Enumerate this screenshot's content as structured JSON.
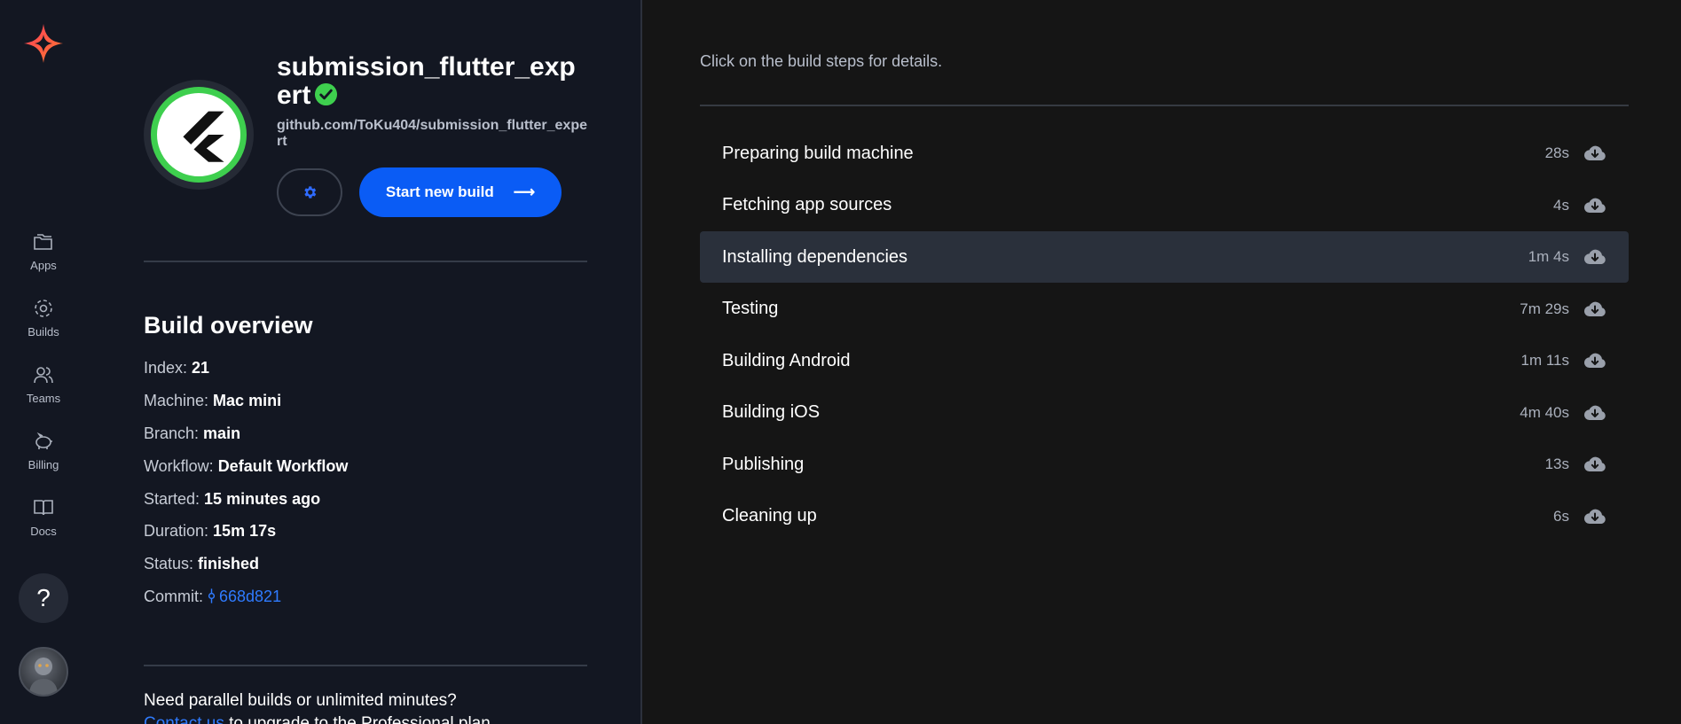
{
  "nav": {
    "items": [
      {
        "label": "Apps",
        "icon": "folder-icon"
      },
      {
        "label": "Builds",
        "icon": "builds-icon"
      },
      {
        "label": "Teams",
        "icon": "users-icon"
      },
      {
        "label": "Billing",
        "icon": "piggy-bank-icon"
      },
      {
        "label": "Docs",
        "icon": "book-icon"
      }
    ],
    "help_label": "?"
  },
  "app": {
    "name": "submission_flutter_expert",
    "repo": "github.com/ToKu404/submission_flutter_expert",
    "start_build_label": "Start new build",
    "start_build_arrow": "⟶"
  },
  "overview": {
    "title": "Build overview",
    "rows": [
      {
        "label": "Index: ",
        "value": "21"
      },
      {
        "label": "Machine: ",
        "value": "Mac mini"
      },
      {
        "label": "Branch: ",
        "value": "main"
      },
      {
        "label": "Workflow: ",
        "value": "Default Workflow"
      },
      {
        "label": "Started: ",
        "value": "15 minutes ago"
      },
      {
        "label": "Duration: ",
        "value": "15m 17s"
      },
      {
        "label": "Status: ",
        "value": "finished"
      }
    ],
    "commit_label": "Commit: ",
    "commit_value": "668d821"
  },
  "promo": {
    "line1": "Need parallel builds or unlimited minutes?",
    "link": "Contact us",
    "line2": " to upgrade to the Professional plan."
  },
  "steps_panel": {
    "hint": "Click on the build steps for details.",
    "steps": [
      {
        "name": "Preparing build machine",
        "time": "28s"
      },
      {
        "name": "Fetching app sources",
        "time": "4s"
      },
      {
        "name": "Installing dependencies",
        "time": "1m 4s",
        "active": true
      },
      {
        "name": "Testing",
        "time": "7m 29s"
      },
      {
        "name": "Building Android",
        "time": "1m 11s"
      },
      {
        "name": "Building iOS",
        "time": "4m 40s"
      },
      {
        "name": "Publishing",
        "time": "13s"
      },
      {
        "name": "Cleaning up",
        "time": "6s"
      }
    ]
  },
  "colors": {
    "accent": "#0a5cf5",
    "verified": "#3ecf4e",
    "link": "#2f7bff"
  }
}
